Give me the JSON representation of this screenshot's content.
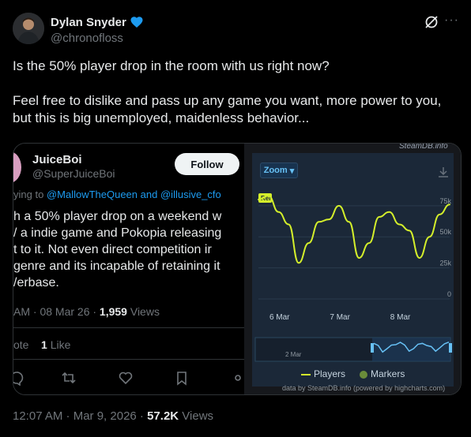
{
  "author": {
    "name": "Dylan Snyder",
    "handle": "@chronofloss"
  },
  "tweet": {
    "paragraphs": [
      "Is the 50% player drop in the room with us right now?",
      "Feel free to dislike and pass up any game you want, more power to you, but this is big unemployed, maidenless behavior..."
    ]
  },
  "quoted": {
    "name": "JuiceBoi",
    "handle": "@SuperJuiceBoi",
    "follow_label": "Follow",
    "reply_prefix": "ying to",
    "reply_to_1": "@MallowTheQueen",
    "reply_and": "and",
    "reply_to_2": "@illusive_cfo",
    "lines": [
      "h a 50% player drop on a weekend w",
      "/ a indie game and Pokopia releasing",
      "t to it. Not even direct competition ir",
      "genre and its incapable of retaining it",
      "/erbase."
    ],
    "meta_time": "AM · 08 Mar 26 ·",
    "meta_views_count": "1,959",
    "meta_views_label": "Views",
    "quote_label": "ote",
    "likes_count": "1",
    "likes_label": "Like"
  },
  "steamdb": {
    "watermark": "SteamDB.info",
    "zoom_label": "Zoom",
    "rel_label": "Rel",
    "y_ticks": [
      "75k",
      "50k",
      "25k",
      "0"
    ],
    "x_ticks": [
      "6 Mar",
      "7 Mar",
      "8 Mar"
    ],
    "navigator_label": "2 Mar",
    "legend_players": "Players",
    "legend_markers": "Markers",
    "credit": "data by SteamDB.info (powered by highcharts.com)",
    "line_color": "#d4ef2b"
  },
  "chart_data": {
    "type": "line",
    "title": "",
    "ylabel": "",
    "ylim": [
      0,
      75000
    ],
    "x": [
      "5 Mar 18:00",
      "6 Mar 00:00",
      "6 Mar 04:00",
      "6 Mar 08:00",
      "6 Mar 12:00",
      "6 Mar 16:00",
      "6 Mar 20:00",
      "7 Mar 00:00",
      "7 Mar 04:00",
      "7 Mar 08:00",
      "7 Mar 12:00",
      "7 Mar 16:00",
      "7 Mar 20:00",
      "8 Mar 00:00",
      "8 Mar 04:00",
      "8 Mar 08:00",
      "8 Mar 12:00",
      "8 Mar 16:00",
      "8 Mar 20:00",
      "9 Mar 00:00"
    ],
    "series": [
      {
        "name": "Players",
        "values": [
          80000,
          83000,
          70000,
          60000,
          29000,
          45000,
          62000,
          64000,
          75000,
          62000,
          33000,
          45000,
          66000,
          70000,
          60000,
          55000,
          33000,
          50000,
          68000,
          76000
        ]
      }
    ]
  },
  "footer": {
    "time": "12:07 AM · Mar 9, 2026 ·",
    "views_count": "57.2K",
    "views_label": "Views"
  }
}
